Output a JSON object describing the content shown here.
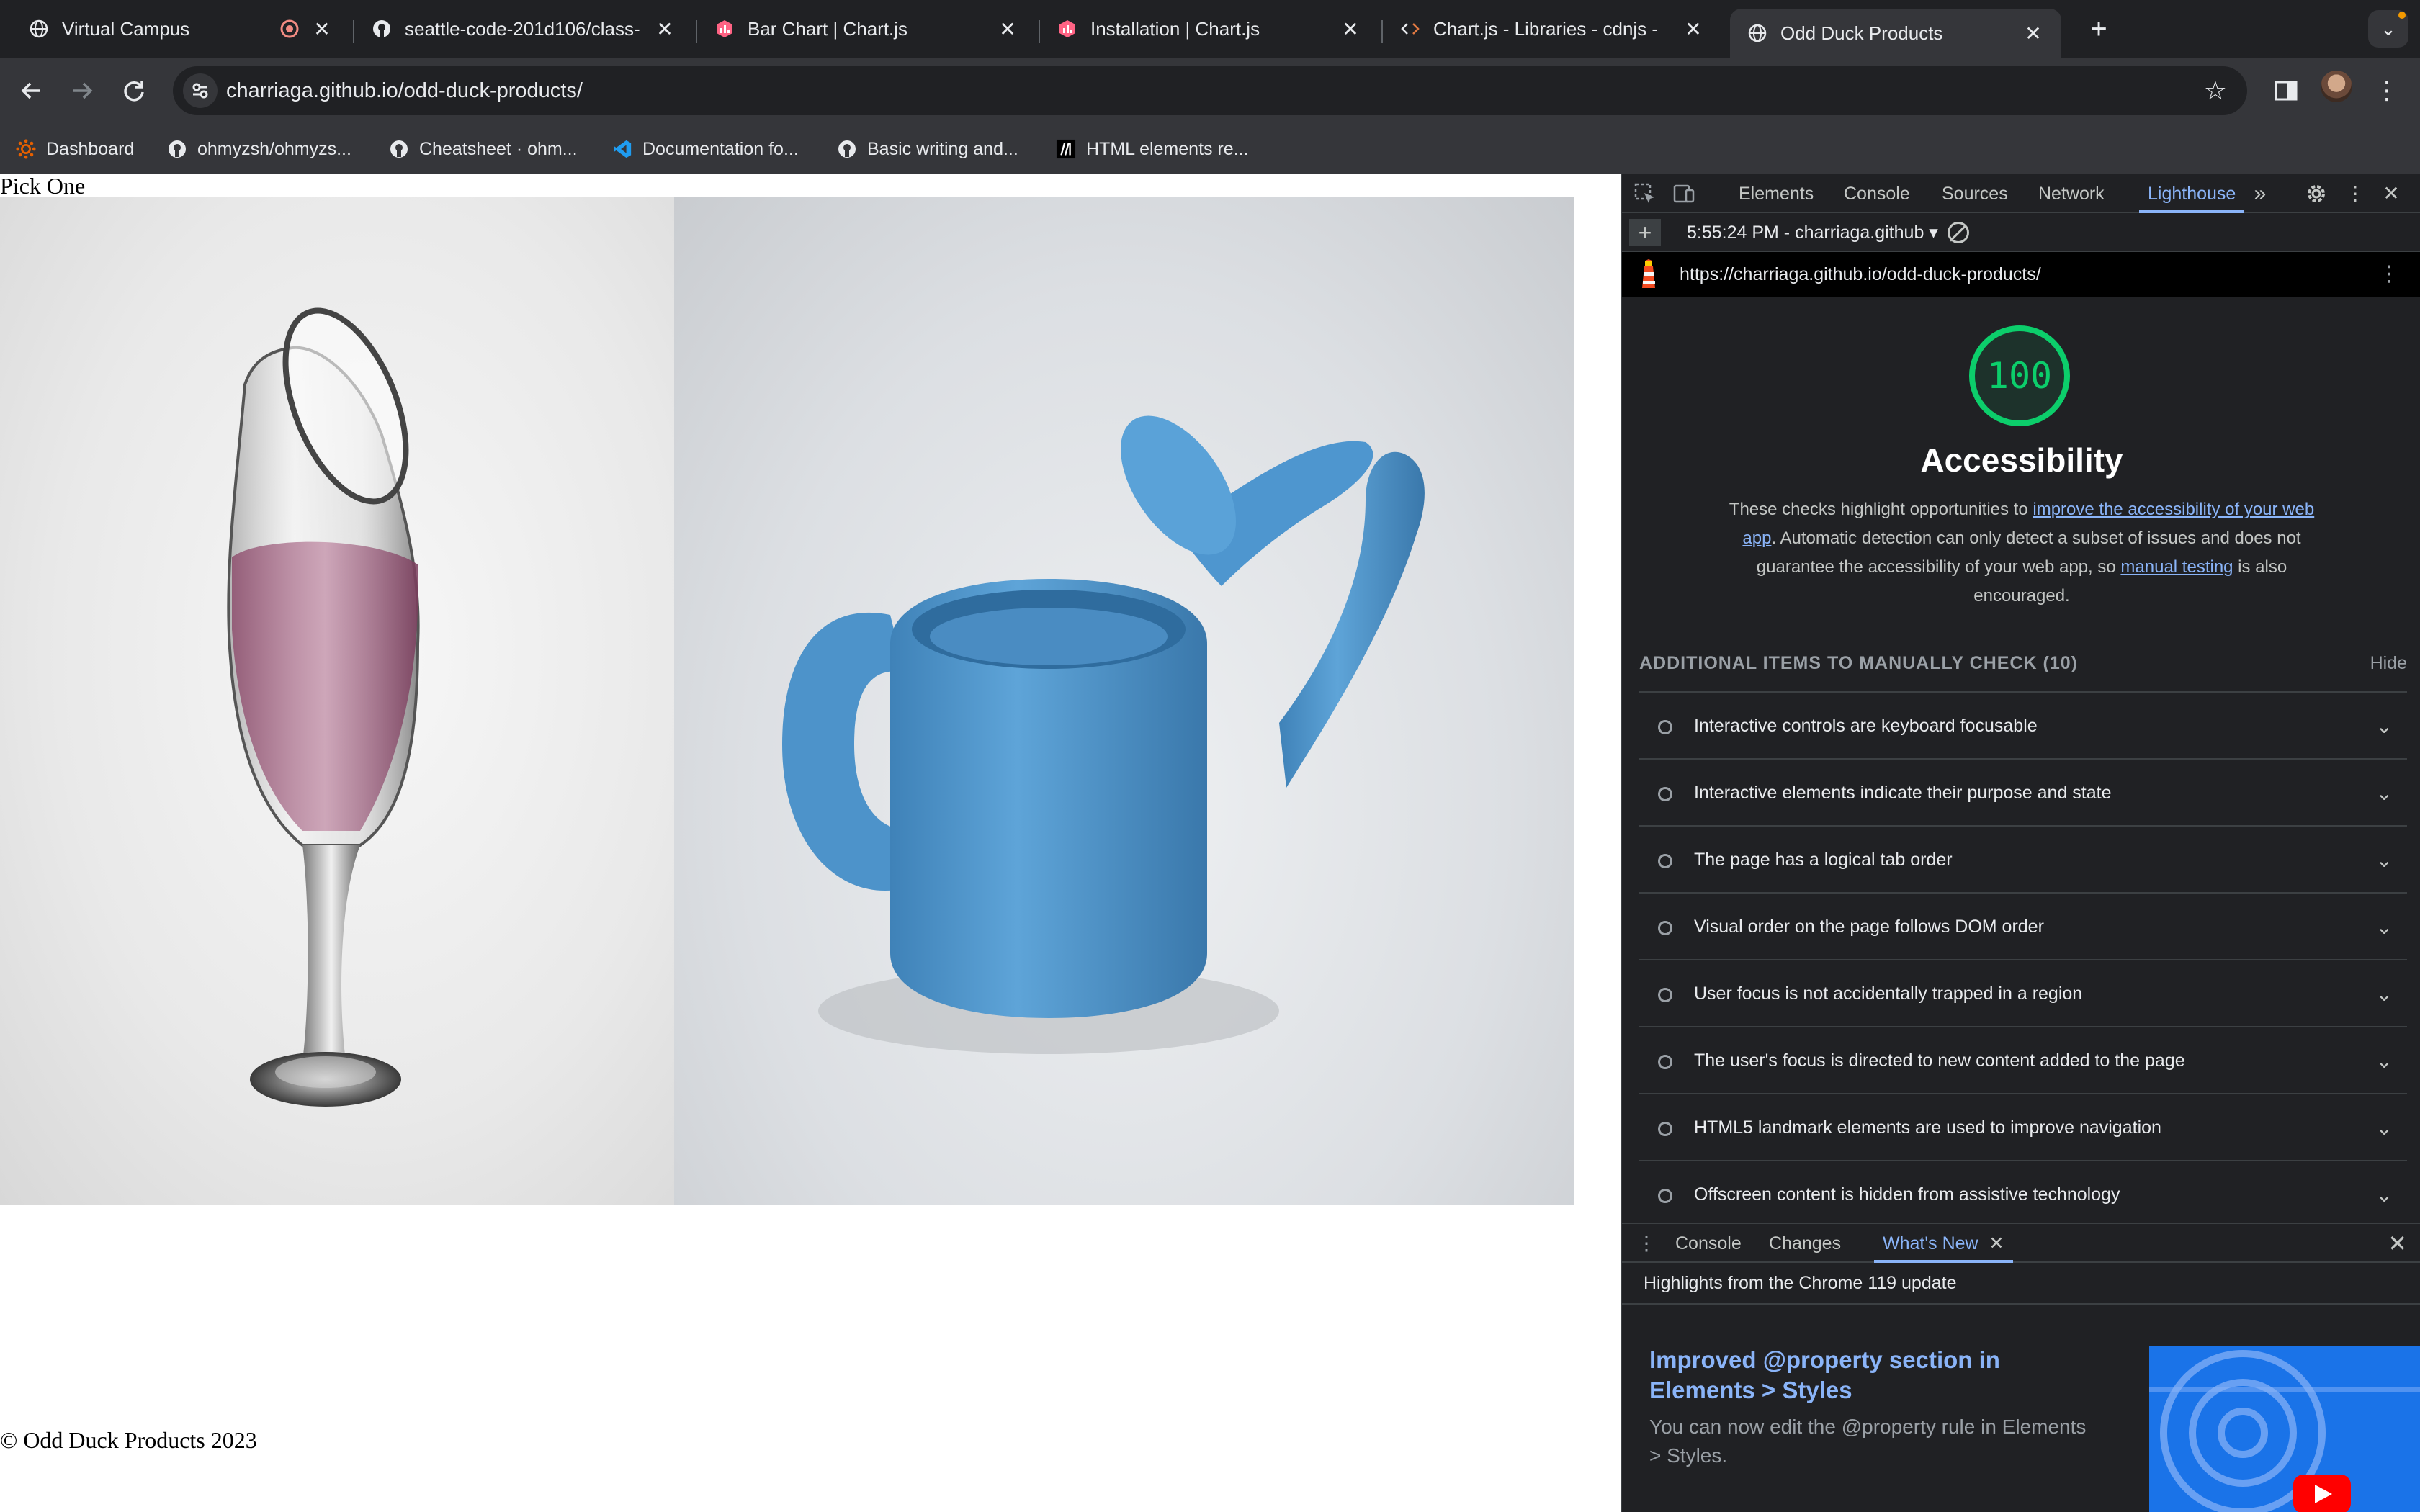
{
  "browser": {
    "tabs": [
      {
        "title": "Virtual Campus",
        "icon": "globe-icon",
        "active": false,
        "recording": true
      },
      {
        "title": "seattle-code-201d106/class-",
        "icon": "github-icon",
        "active": false
      },
      {
        "title": "Bar Chart | Chart.js",
        "icon": "chartjs-icon",
        "active": false
      },
      {
        "title": "Installation | Chart.js",
        "icon": "chartjs-icon",
        "active": false
      },
      {
        "title": "Chart.js - Libraries - cdnjs -",
        "icon": "code-icon",
        "active": false
      },
      {
        "title": "Odd Duck Products",
        "icon": "globe-icon",
        "active": true
      }
    ],
    "address": "charriaga.github.io/odd-duck-products/",
    "bookmarks": [
      {
        "label": "Dashboard",
        "icon": "canvas-icon"
      },
      {
        "label": "ohmyzsh/ohmyzs...",
        "icon": "github-icon"
      },
      {
        "label": "Cheatsheet · ohm...",
        "icon": "github-icon"
      },
      {
        "label": "Documentation fo...",
        "icon": "vscode-icon"
      },
      {
        "label": "Basic writing and...",
        "icon": "github-icon"
      },
      {
        "label": "HTML elements re...",
        "icon": "mdn-icon"
      }
    ]
  },
  "page": {
    "heading": "Pick One",
    "products": [
      {
        "name": "wine-glass",
        "alt_icon": "wine-glass-product-image"
      },
      {
        "name": "watering-can",
        "alt_icon": "watering-can-product-image"
      }
    ],
    "footer": "© Odd Duck Products 2023"
  },
  "devtools": {
    "tabs": [
      "Elements",
      "Console",
      "Sources",
      "Network",
      "Lighthouse"
    ],
    "active_tab": "Lighthouse",
    "report_select": "5:55:24 PM - charriaga.github",
    "report_url": "https://charriaga.github.io/odd-duck-products/",
    "score": "100",
    "score_color": "#0cce6b",
    "category_title": "Accessibility",
    "description": {
      "part1": "These checks highlight opportunities to ",
      "link1": "improve the accessibility of your web app",
      "part2": ". Automatic detection can only detect a subset of issues and does not guarantee the accessibility of your web app, so ",
      "link2": "manual testing",
      "part3": " is also encouraged."
    },
    "manual_header": "ADDITIONAL ITEMS TO MANUALLY CHECK (10)",
    "hide_label": "Hide",
    "audits": [
      "Interactive controls are keyboard focusable",
      "Interactive elements indicate their purpose and state",
      "The page has a logical tab order",
      "Visual order on the page follows DOM order",
      "User focus is not accidentally trapped in a region",
      "The user's focus is directed to new content added to the page",
      "HTML5 landmark elements are used to improve navigation",
      "Offscreen content is hidden from assistive technology"
    ],
    "drawer": {
      "tabs": [
        "Console",
        "Changes",
        "What's New"
      ],
      "active_tab": "What's New",
      "highlights": "Highlights from the Chrome 119 update",
      "feature_title": "Improved @property section in Elements > Styles",
      "feature_desc": "You can now edit the @property rule in Elements > Styles."
    }
  }
}
